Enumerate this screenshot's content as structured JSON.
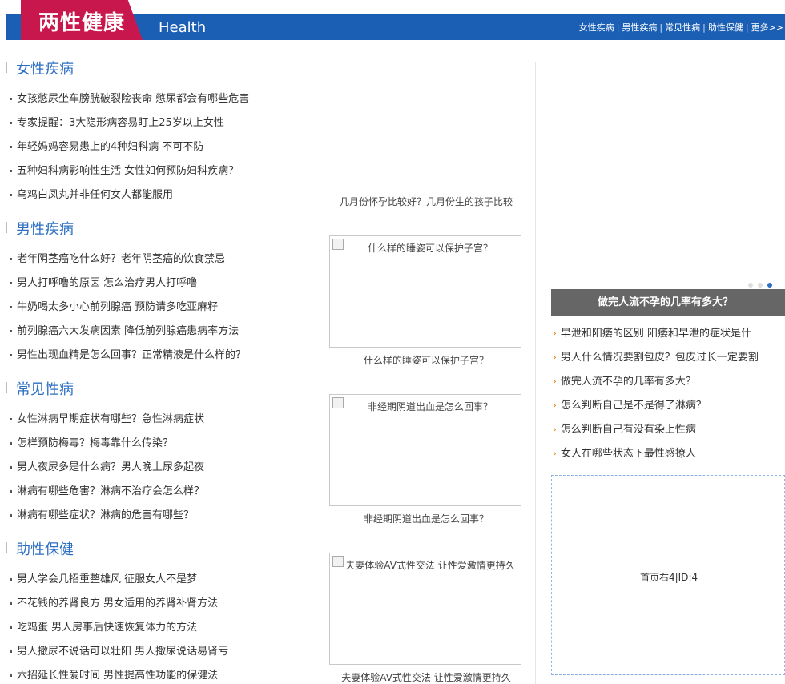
{
  "header": {
    "title": "两性健康",
    "subtitle": "Health",
    "nav": [
      "女性疾病",
      "男性疾病",
      "常见性病",
      "助性保健",
      "更多>>"
    ]
  },
  "sections": [
    {
      "title": "女性疾病",
      "items": [
        "女孩憋尿坐车膀胱破裂险丧命 憋尿都会有哪些危害",
        "专家提醒：3大隐形病容易盯上25岁以上女性",
        "年轻妈妈容易患上的4种妇科病 不可不防",
        "五种妇科病影响性生活 女性如何预防妇科疾病？",
        "乌鸡白凤丸并非任何女人都能服用"
      ]
    },
    {
      "title": "男性疾病",
      "items": [
        "老年阴茎癌吃什么好？老年阴茎癌的饮食禁忌",
        "男人打呼噜的原因 怎么治疗男人打呼噜",
        "牛奶喝太多小心前列腺癌 预防请多吃亚麻籽",
        "前列腺癌六大发病因素 降低前列腺癌患病率方法",
        "男性出现血精是怎么回事？正常精液是什么样的？"
      ]
    },
    {
      "title": "常见性病",
      "items": [
        "女性淋病早期症状有哪些？急性淋病症状",
        "怎样预防梅毒？梅毒靠什么传染？",
        "男人夜尿多是什么病？男人晚上尿多起夜",
        "淋病有哪些危害？淋病不治疗会怎么样？",
        "淋病有哪些症状？淋病的危害有哪些？"
      ]
    },
    {
      "title": "助性保健",
      "items": [
        "男人学会几招重整雄风 征服女人不是梦",
        "不花钱的养肾良方 男女适用的养肾补肾方法",
        "吃鸡蛋 男人房事后快速恢复体力的方法",
        "男人撒尿不说话可以壮阳 男人撒尿说话易肾亏",
        "六招延长性爱时间 男性提高性功能的保健法"
      ]
    }
  ],
  "middle": {
    "top_caption": "几月份怀孕比较好？几月份生的孩子比较",
    "images": [
      {
        "alt": "什么样的睡姿可以保护子宫？",
        "caption": "什么样的睡姿可以保护子宫？"
      },
      {
        "alt": "非经期阴道出血是怎么回事？",
        "caption": "非经期阴道出血是怎么回事？"
      },
      {
        "alt": "夫妻体验AV式性交法 让性爱激情更持久",
        "caption": "夫妻体验AV式性交法 让性爱激情更持久"
      }
    ]
  },
  "right": {
    "banner": "做完人流不孕的几率有多大？",
    "items": [
      "早泄和阳痿的区别 阳痿和早泄的症状是什",
      "男人什么情况要割包皮？包皮过长一定要割",
      "做完人流不孕的几率有多大？",
      "怎么判断自己是不是得了淋病？",
      "怎么判断自己有没有染上性病",
      "女人在哪些状态下最性感撩人"
    ],
    "ad_label": "首页右4|ID:4"
  }
}
